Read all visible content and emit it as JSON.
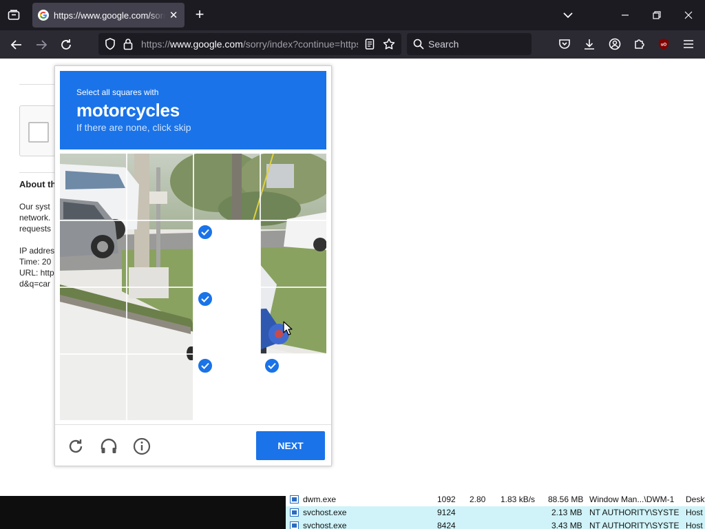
{
  "browser": {
    "tab": {
      "title": "https://www.google.com/sorry/index?continue=https",
      "favicon": "google-g-icon"
    },
    "address_bar": {
      "url_prefix": "https://",
      "url_host": "www.google.com",
      "url_path": "/sorry/index?continue=https"
    },
    "search": {
      "placeholder": "Search"
    },
    "colors": {
      "tab_strip": "#1c1b22",
      "toolbar": "#2b2a33",
      "active_tab": "#42414d"
    }
  },
  "background_page": {
    "about_heading": "About th",
    "lines": [
      "Our syst",
      "network.",
      "requests",
      "IP addres",
      "Time: 20",
      "URL: http",
      "d&q=car"
    ]
  },
  "challenge": {
    "instruction": "Select all squares with",
    "target": "motorcycles",
    "hint": "If there are none, click skip",
    "grid": {
      "rows": 4,
      "cols": 4,
      "selected": [
        [
          1,
          2
        ],
        [
          2,
          2
        ],
        [
          3,
          2
        ],
        [
          3,
          3
        ]
      ]
    },
    "next_label": "NEXT",
    "footer_icons": [
      "reload-icon",
      "audio-headphones-icon",
      "info-icon"
    ],
    "accent_color": "#1a73e8"
  },
  "task_manager": {
    "rows": [
      {
        "name": "dwm.exe",
        "pid": "1092",
        "cpu": "2.80",
        "io": "1.83 kB/s",
        "memory": "88.56 MB",
        "user": "Window Man...\\DWM-1",
        "desc": "Deskt",
        "highlight": false
      },
      {
        "name": "svchost.exe",
        "pid": "9124",
        "cpu": "",
        "io": "",
        "memory": "2.13 MB",
        "user": "NT AUTHORITY\\SYSTEM",
        "desc": "Host",
        "highlight": true
      },
      {
        "name": "svchost.exe",
        "pid": "8424",
        "cpu": "",
        "io": "",
        "memory": "3.43 MB",
        "user": "NT AUTHORITY\\SYSTEM",
        "desc": "Host",
        "highlight": true
      }
    ]
  }
}
